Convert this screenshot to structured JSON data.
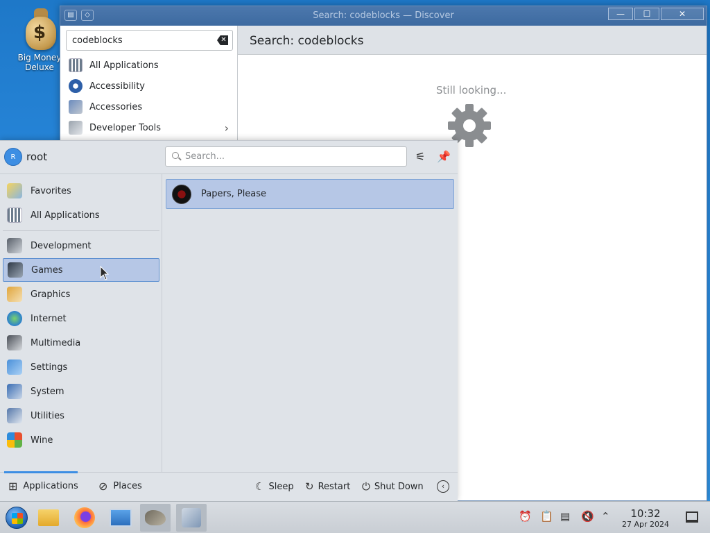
{
  "desktop": {
    "icon_label": "Big Money Deluxe",
    "icon_label_line1": "Big Money",
    "icon_label_line2": "Deluxe"
  },
  "discover": {
    "window_title": "Search: codeblocks — Discover",
    "search_value": "codeblocks",
    "header": "Search: codeblocks",
    "status": "Still looking...",
    "sidebar": [
      {
        "label": "All Applications",
        "icon": "grid-icon"
      },
      {
        "label": "Accessibility",
        "icon": "accessibility-icon"
      },
      {
        "label": "Accessories",
        "icon": "accessories-icon"
      },
      {
        "label": "Developer Tools",
        "icon": "developer-tools-icon"
      }
    ]
  },
  "launcher": {
    "user_initial": "R",
    "user": "root",
    "search_placeholder": "Search...",
    "categories": [
      {
        "label": "Favorites",
        "icon": "favorites-icon"
      },
      {
        "label": "All Applications",
        "icon": "grid-icon"
      },
      {
        "label": "Development",
        "icon": "development-icon"
      },
      {
        "label": "Games",
        "icon": "games-icon",
        "selected": true
      },
      {
        "label": "Graphics",
        "icon": "graphics-icon"
      },
      {
        "label": "Internet",
        "icon": "internet-icon"
      },
      {
        "label": "Multimedia",
        "icon": "multimedia-icon"
      },
      {
        "label": "Settings",
        "icon": "settings-icon"
      },
      {
        "label": "System",
        "icon": "system-icon"
      },
      {
        "label": "Utilities",
        "icon": "utilities-icon"
      },
      {
        "label": "Wine",
        "icon": "wine-icon"
      }
    ],
    "results": [
      {
        "label": "Papers, Please"
      }
    ],
    "tabs": {
      "applications": "Applications",
      "places": "Places"
    },
    "power": {
      "sleep": "Sleep",
      "restart": "Restart",
      "shutdown": "Shut Down"
    }
  },
  "taskbar": {
    "apps": [
      "start-menu-icon",
      "file-manager-icon",
      "firefox-icon",
      "system-settings-icon",
      "gimp-icon",
      "discover-icon"
    ],
    "clock_time": "10:32",
    "clock_date": "27 Apr 2024"
  },
  "colors": {
    "accent": "#3d8ee3",
    "selection": "#b6c7e6",
    "panel": "#dfe3e8"
  }
}
